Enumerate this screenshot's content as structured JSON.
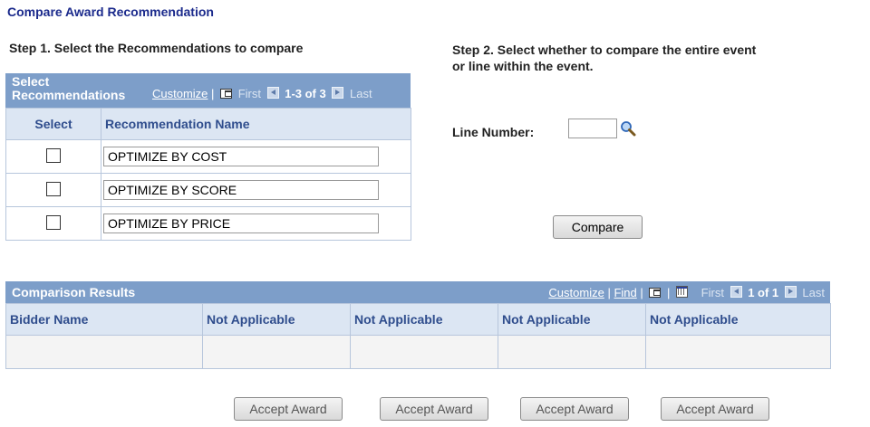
{
  "page_title": "Compare Award Recommendation",
  "step1": "Step 1. Select the Recommendations to compare",
  "step2_line1": "Step 2. Select whether to compare the entire event",
  "step2_line2": "or line within the event.",
  "select_grid": {
    "title_line1": "Select",
    "title_line2": "Recommendations",
    "customize": "Customize",
    "sep": "|",
    "first": "First",
    "range": "1-3 of 3",
    "last": "Last",
    "col_select": "Select",
    "col_name": "Recommendation Name",
    "rows": [
      {
        "checked": false,
        "name": "OPTIMIZE BY COST"
      },
      {
        "checked": false,
        "name": "OPTIMIZE BY SCORE"
      },
      {
        "checked": false,
        "name": "OPTIMIZE BY PRICE"
      }
    ]
  },
  "line_number": {
    "label": "Line Number:",
    "value": ""
  },
  "compare_button": "Compare",
  "results_grid": {
    "title": "Comparison Results",
    "customize": "Customize",
    "find": "Find",
    "sep": "|",
    "first": "First",
    "range": "1 of 1",
    "last": "Last",
    "columns": [
      "Bidder Name",
      "Not Applicable",
      "Not Applicable",
      "Not Applicable",
      "Not Applicable"
    ]
  },
  "accept_buttons": [
    "Accept Award",
    "Accept Award",
    "Accept Award",
    "Accept Award"
  ],
  "colors": {
    "header_bg": "#7d9ec9",
    "col_header_bg": "#dce6f3",
    "title": "#1b2a8c"
  }
}
